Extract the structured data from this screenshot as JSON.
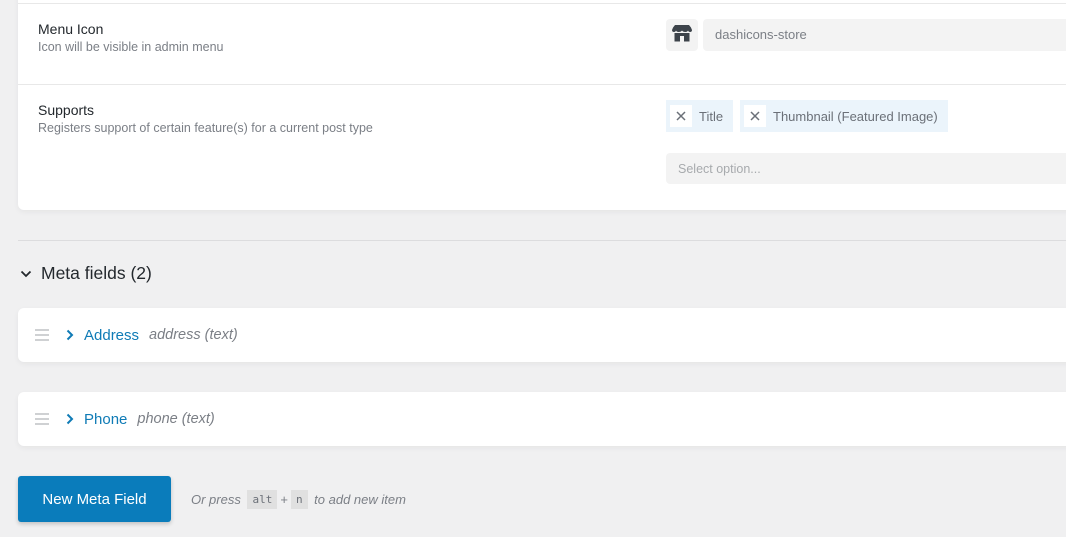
{
  "settings": {
    "menu_icon": {
      "label": "Menu Icon",
      "description": "Icon will be visible in admin menu",
      "icon_name": "store-icon",
      "value": "dashicons-store"
    },
    "supports": {
      "label": "Supports",
      "description": "Registers support of certain feature(s) for a current post type",
      "selected": [
        {
          "label": "Title"
        },
        {
          "label": "Thumbnail (Featured Image)"
        }
      ],
      "placeholder": "Select option..."
    }
  },
  "meta_section": {
    "title": "Meta fields (2)",
    "fields": [
      {
        "name": "Address",
        "slug": "address (text)"
      },
      {
        "name": "Phone",
        "slug": "phone (text)"
      }
    ]
  },
  "footer": {
    "button_label": "New Meta Field",
    "hint_prefix": "Or press ",
    "key1": "alt",
    "plus": "+",
    "key2": "n",
    "hint_suffix": " to add new item"
  },
  "colors": {
    "accent": "#0a7cbb",
    "link": "#0f7bb6",
    "chip_bg": "#ebf4fb",
    "page_bg": "#f0f0f1"
  }
}
